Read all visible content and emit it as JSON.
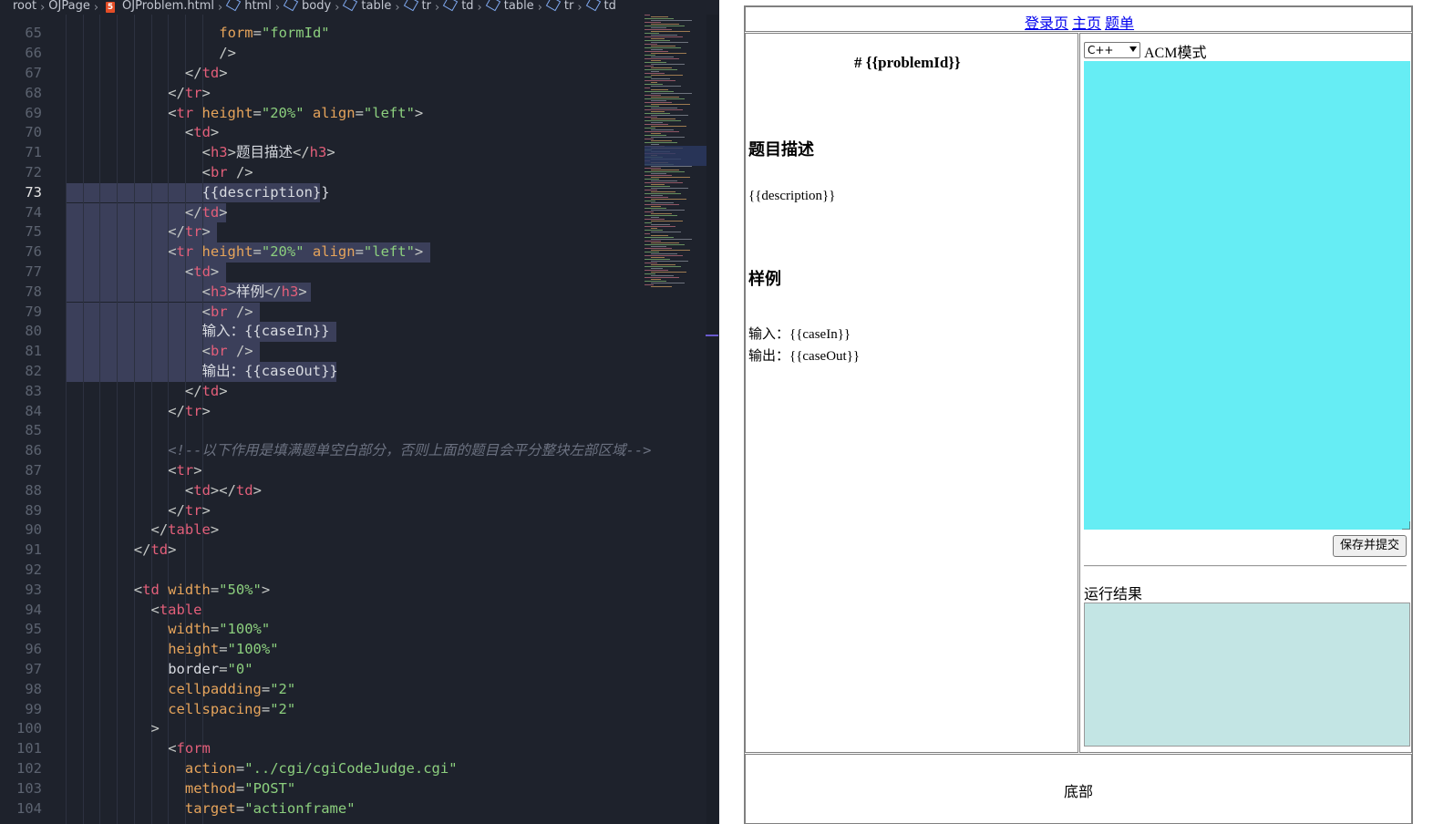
{
  "editor": {
    "breadcrumb": [
      "root",
      "OJPage",
      "OJProblem.html",
      "html",
      "body",
      "table",
      "tr",
      "td",
      "table",
      "tr",
      "td"
    ],
    "current_line": 73,
    "line_numbers": [
      "65",
      "66",
      "67",
      "68",
      "69",
      "70",
      "71",
      "72",
      "73",
      "74",
      "75",
      "76",
      "77",
      "78",
      "79",
      "80",
      "81",
      "82",
      "83",
      "84",
      "85",
      "86",
      "87",
      "88",
      "89",
      "90",
      "91",
      "92",
      "93",
      "94",
      "95",
      "96",
      "97",
      "98",
      "99",
      "100",
      "101",
      "102",
      "103",
      "104"
    ],
    "code": [
      [
        [
          "t-attr",
          "form"
        ],
        [
          "t-br",
          "="
        ],
        [
          "t-str",
          "\"formId\""
        ]
      ],
      [
        [
          "t-br",
          "/>"
        ]
      ],
      [
        [
          "t-br",
          "</"
        ],
        [
          "t-tag",
          "td"
        ],
        [
          "t-br",
          ">"
        ]
      ],
      [
        [
          "t-br",
          "</"
        ],
        [
          "t-tag",
          "tr"
        ],
        [
          "t-br",
          ">"
        ]
      ],
      [
        [
          "t-br",
          "<"
        ],
        [
          "t-tag",
          "tr"
        ],
        [
          "t-tx",
          " "
        ],
        [
          "t-attr",
          "height"
        ],
        [
          "t-br",
          "="
        ],
        [
          "t-str",
          "\"20%\""
        ],
        [
          "t-tx",
          " "
        ],
        [
          "t-attr",
          "align"
        ],
        [
          "t-br",
          "="
        ],
        [
          "t-str",
          "\"left\""
        ],
        [
          "t-br",
          ">"
        ]
      ],
      [
        [
          "t-br",
          "<"
        ],
        [
          "t-tag",
          "td"
        ],
        [
          "t-br",
          ">"
        ]
      ],
      [
        [
          "t-br",
          "<"
        ],
        [
          "t-tag",
          "h3"
        ],
        [
          "t-br",
          ">"
        ],
        [
          "t-tx",
          "题目描述"
        ],
        [
          "t-br",
          "</"
        ],
        [
          "t-tag",
          "h3"
        ],
        [
          "t-br",
          ">"
        ]
      ],
      [
        [
          "t-br",
          "<"
        ],
        [
          "t-tag",
          "br"
        ],
        [
          "t-tx",
          " "
        ],
        [
          "t-br",
          "/>"
        ]
      ],
      [
        [
          "t-tx",
          "{{description}}"
        ]
      ],
      [
        [
          "t-br",
          "</"
        ],
        [
          "t-tag",
          "td"
        ],
        [
          "t-br",
          ">"
        ]
      ],
      [
        [
          "t-br",
          "</"
        ],
        [
          "t-tag",
          "tr"
        ],
        [
          "t-br",
          ">"
        ]
      ],
      [
        [
          "t-br",
          "<"
        ],
        [
          "t-tag",
          "tr"
        ],
        [
          "t-tx",
          " "
        ],
        [
          "t-attr",
          "height"
        ],
        [
          "t-br",
          "="
        ],
        [
          "t-str",
          "\"20%\""
        ],
        [
          "t-tx",
          " "
        ],
        [
          "t-attr",
          "align"
        ],
        [
          "t-br",
          "="
        ],
        [
          "t-str",
          "\"left\""
        ],
        [
          "t-br",
          ">"
        ]
      ],
      [
        [
          "t-br",
          "<"
        ],
        [
          "t-tag",
          "td"
        ],
        [
          "t-br",
          ">"
        ]
      ],
      [
        [
          "t-br",
          "<"
        ],
        [
          "t-tag",
          "h3"
        ],
        [
          "t-br",
          ">"
        ],
        [
          "t-tx",
          "样例"
        ],
        [
          "t-br",
          "</"
        ],
        [
          "t-tag",
          "h3"
        ],
        [
          "t-br",
          ">"
        ]
      ],
      [
        [
          "t-br",
          "<"
        ],
        [
          "t-tag",
          "br"
        ],
        [
          "t-tx",
          " "
        ],
        [
          "t-br",
          "/>"
        ]
      ],
      [
        [
          "t-tx",
          "输入：{{caseIn}}"
        ]
      ],
      [
        [
          "t-br",
          "<"
        ],
        [
          "t-tag",
          "br"
        ],
        [
          "t-tx",
          " "
        ],
        [
          "t-br",
          "/>"
        ]
      ],
      [
        [
          "t-tx",
          "输出：{{caseOut}}"
        ]
      ],
      [
        [
          "t-br",
          "</"
        ],
        [
          "t-tag",
          "td"
        ],
        [
          "t-br",
          ">"
        ]
      ],
      [
        [
          "t-br",
          "</"
        ],
        [
          "t-tag",
          "tr"
        ],
        [
          "t-br",
          ">"
        ]
      ],
      [],
      [
        [
          "t-cm",
          "<!--以下作用是填满题单空白部分，否则上面的题目会平分整块左部区域-->"
        ]
      ],
      [
        [
          "t-br",
          "<"
        ],
        [
          "t-tag",
          "tr"
        ],
        [
          "t-br",
          ">"
        ]
      ],
      [
        [
          "t-br",
          "<"
        ],
        [
          "t-tag",
          "td"
        ],
        [
          "t-br",
          "></"
        ],
        [
          "t-tag",
          "td"
        ],
        [
          "t-br",
          ">"
        ]
      ],
      [
        [
          "t-br",
          "</"
        ],
        [
          "t-tag",
          "tr"
        ],
        [
          "t-br",
          ">"
        ]
      ],
      [
        [
          "t-br",
          "</"
        ],
        [
          "t-tag",
          "table"
        ],
        [
          "t-br",
          ">"
        ]
      ],
      [
        [
          "t-br",
          "</"
        ],
        [
          "t-tag",
          "td"
        ],
        [
          "t-br",
          ">"
        ]
      ],
      [],
      [
        [
          "t-br",
          "<"
        ],
        [
          "t-tag",
          "td"
        ],
        [
          "t-tx",
          " "
        ],
        [
          "t-attr",
          "width"
        ],
        [
          "t-br",
          "="
        ],
        [
          "t-str",
          "\"50%\""
        ],
        [
          "t-br",
          ">"
        ]
      ],
      [
        [
          "t-br",
          "<"
        ],
        [
          "t-tag",
          "table"
        ]
      ],
      [
        [
          "t-attr",
          "width"
        ],
        [
          "t-br",
          "="
        ],
        [
          "t-str",
          "\"100%\""
        ]
      ],
      [
        [
          "t-attr",
          "height"
        ],
        [
          "t-br",
          "="
        ],
        [
          "t-str",
          "\"100%\""
        ]
      ],
      [
        [
          "t-tx",
          "border"
        ],
        [
          "t-br",
          "="
        ],
        [
          "t-str",
          "\"0\""
        ]
      ],
      [
        [
          "t-attr",
          "cellpadding"
        ],
        [
          "t-br",
          "="
        ],
        [
          "t-str",
          "\"2\""
        ]
      ],
      [
        [
          "t-attr",
          "cellspacing"
        ],
        [
          "t-br",
          "="
        ],
        [
          "t-str",
          "\"2\""
        ]
      ],
      [
        [
          "t-br",
          ">"
        ]
      ],
      [
        [
          "t-br",
          "<"
        ],
        [
          "t-tag",
          "form"
        ]
      ],
      [
        [
          "t-attr",
          "action"
        ],
        [
          "t-br",
          "="
        ],
        [
          "t-str",
          "\"../cgi/cgiCodeJudge.cgi\""
        ]
      ],
      [
        [
          "t-attr",
          "method"
        ],
        [
          "t-br",
          "="
        ],
        [
          "t-str",
          "\"POST\""
        ]
      ],
      [
        [
          "t-attr",
          "target"
        ],
        [
          "t-br",
          "="
        ],
        [
          "t-str",
          "\"actionframe\""
        ]
      ]
    ],
    "indent": [
      9,
      9,
      7,
      6,
      6,
      7,
      8,
      8,
      8,
      7,
      6,
      6,
      7,
      8,
      8,
      8,
      8,
      8,
      7,
      6,
      0,
      6,
      6,
      7,
      6,
      5,
      4,
      0,
      4,
      5,
      6,
      6,
      6,
      6,
      6,
      5,
      6,
      7,
      7,
      7
    ]
  },
  "preview": {
    "nav_links": [
      "登录页",
      "主页",
      "题单"
    ],
    "problem_title": "# {{problemId}}",
    "description_heading": "题目描述",
    "description_text": "{{description}}",
    "sample_heading": "样例",
    "case_in": "输入：{{caseIn}}",
    "case_out": "输出：{{caseOut}}",
    "language_selected": "C++",
    "mode_label": "ACM模式",
    "code_area_color": "#66edf4",
    "submit_label": "保存并提交",
    "result_label": "运行结果",
    "result_area_color": "#c3e5e4",
    "footer_text": "底部"
  }
}
